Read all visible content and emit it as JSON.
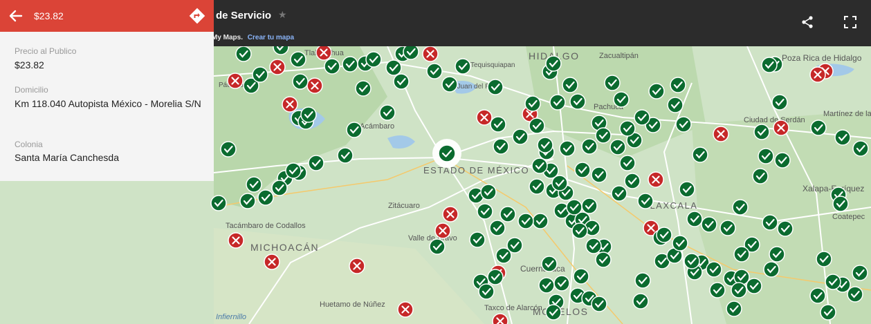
{
  "header": {
    "title": "de Servicio",
    "subtitle_brand": "My Maps.",
    "subtitle_link": "Crear tu mapa"
  },
  "panel": {
    "title": "$23.82",
    "fields": [
      {
        "label": "Precio al Publico",
        "value": "$23.82"
      },
      {
        "label": "Domicilio",
        "value": "Km 118.040 Autopista México - Morelia S/N"
      },
      {
        "label": "Colonia",
        "value": "Santa María Canchesda"
      }
    ]
  },
  "map": {
    "labels": [
      {
        "text": "HIDALGO"
      },
      {
        "text": "Zacualtipán"
      },
      {
        "text": "Poza Rica de Hidalgo"
      },
      {
        "text": "Tequisquiapan"
      },
      {
        "text": "ESTADO DE MÉXICO"
      },
      {
        "text": "Zitácuaro"
      },
      {
        "text": "Tacámbaro de Codallos"
      },
      {
        "text": "MICHOACÁN"
      },
      {
        "text": "Valle de Bravo"
      },
      {
        "text": "TLAXCALA"
      },
      {
        "text": "Xalapa-Enríquez"
      },
      {
        "text": "Coatepec"
      },
      {
        "text": "Martínez de la Torre"
      },
      {
        "text": "Ciudad de Serdán"
      },
      {
        "text": "Pachuca"
      },
      {
        "text": "Acámbaro"
      },
      {
        "text": "Huetamo de Núñez"
      },
      {
        "text": "Taxco de Alarcón"
      },
      {
        "text": "MORELOS"
      },
      {
        "text": "Cuernavaca"
      },
      {
        "text": "Tlalpujahua"
      },
      {
        "text": "San Juan del Río"
      },
      {
        "text": "Infiernillo"
      },
      {
        "text": "Pátzcuaro"
      }
    ],
    "colors": {
      "valid": "#0b6b2f",
      "invalid": "#c62828",
      "water": "#a3c9e8",
      "land": "#cfe3c6",
      "road": "#ffffff"
    }
  }
}
